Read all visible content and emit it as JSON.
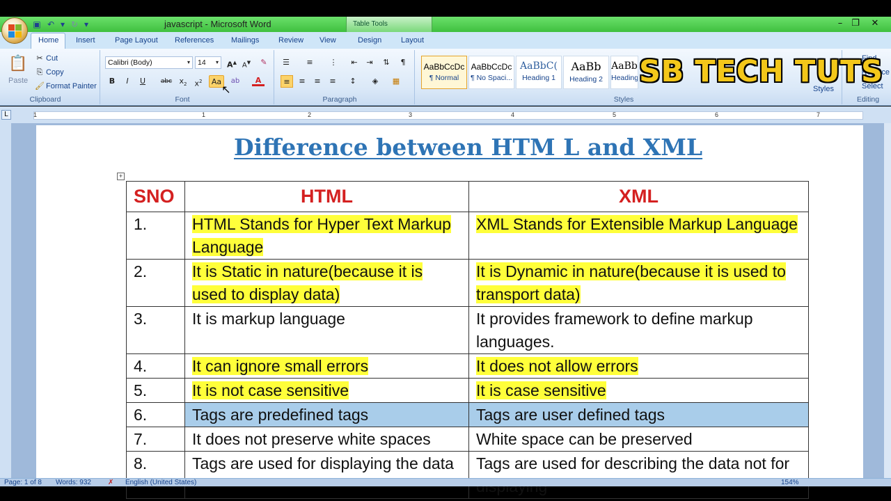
{
  "window": {
    "title": "javascript - Microsoft Word",
    "contextual_tab_group": "Table Tools",
    "controls": [
      "–",
      "❐",
      "✕"
    ]
  },
  "tabs": [
    "Home",
    "Insert",
    "Page Layout",
    "References",
    "Mailings",
    "Review",
    "View",
    "Design",
    "Layout"
  ],
  "clipboard": {
    "paste": "Paste",
    "cut": "Cut",
    "copy": "Copy",
    "format_painter": "Format Painter",
    "label": "Clipboard"
  },
  "font": {
    "family": "Calibri (Body)",
    "size": "14",
    "label": "Font"
  },
  "paragraph": {
    "label": "Paragraph"
  },
  "styles": {
    "label": "Styles",
    "items": [
      {
        "preview": "AaBbCcDc",
        "name": "¶ Normal"
      },
      {
        "preview": "AaBbCcDc",
        "name": "¶ No Spaci..."
      },
      {
        "preview": "AaBbC(",
        "name": "Heading 1"
      },
      {
        "preview": "AaBb",
        "name": "Heading 2"
      },
      {
        "preview": "AaBb",
        "name": "Heading"
      }
    ],
    "change_styles": "Styles"
  },
  "editing": {
    "find": "Find",
    "replace": "Replace",
    "select": "Select",
    "label": "Editing"
  },
  "brand_watermark": "SB TECH TUTS",
  "ruler_numbers": [
    "1",
    "1",
    "2",
    "3",
    "4",
    "5",
    "6",
    "7"
  ],
  "document": {
    "heading": "Difference between HTM L and XML",
    "table": {
      "headers": [
        "SNO",
        "HTML",
        "XML"
      ],
      "rows": [
        {
          "sno": "1.",
          "html": "HTML Stands for Hyper Text Markup Language",
          "xml": "XML Stands for Extensible Markup Language"
        },
        {
          "sno": "2.",
          "html": "It is Static in nature(because it is used to display data)",
          "xml": "It is Dynamic in nature(because it is used to transport data)"
        },
        {
          "sno": "3.",
          "html": "It is markup language",
          "xml": "It provides framework to define markup languages."
        },
        {
          "sno": "4.",
          "html": "It can ignore small errors",
          "xml": "It does not allow errors"
        },
        {
          "sno": "5.",
          "html": "It is not case sensitive",
          "xml": "It is case sensitive"
        },
        {
          "sno": "6.",
          "html": "Tags are predefined tags",
          "xml": "Tags are user defined tags"
        },
        {
          "sno": "7.",
          "html": "It does not preserve white spaces",
          "xml": "White space can be preserved"
        },
        {
          "sno": "8.",
          "html": "Tags are used for displaying the data",
          "xml": "Tags are used for describing the data not for displaying"
        }
      ]
    }
  },
  "status": {
    "page": "Page: 1 of 8",
    "words": "Words: 932",
    "language": "English (United States)",
    "zoom": "154%"
  },
  "colors": {
    "title_bar": "#3fc03f",
    "heading": "#2e74b5",
    "table_header": "#d42020",
    "highlight": "#ffff3a",
    "selected_row": "#a9cdea",
    "brand": "#f3c71a"
  }
}
